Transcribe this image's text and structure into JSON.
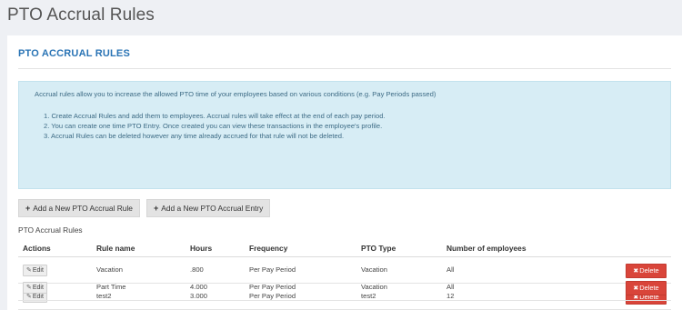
{
  "page": {
    "title": "PTO Accrual Rules"
  },
  "panel": {
    "heading": "PTO ACCRUAL RULES"
  },
  "info": {
    "intro": "Accrual rules allow you to increase the allowed PTO time of your employees based on various conditions (e.g. Pay Periods passed)",
    "items": [
      "1. Create Accrual Rules and add them to employees. Accrual rules will take effect at the end of each pay period.",
      "2. You can create one time PTO Entry. Once created you can view these transactions in the employee's profile.",
      "3. Accrual Rules can be deleted however any time already accrued for that rule will not be deleted."
    ]
  },
  "buttons": {
    "add_rule": "Add a New PTO Accrual Rule",
    "add_entry": "Add a New PTO Accrual Entry",
    "plus_icon": "+",
    "edit_label": "Edit",
    "edit_icon": "✎",
    "delete_label": "Delete",
    "delete_icon": "✖"
  },
  "table": {
    "label": "PTO Accrual Rules",
    "headers": [
      "Actions",
      "Rule name",
      "Hours",
      "Frequency",
      "PTO Type",
      "Number of employees"
    ],
    "rows": [
      {
        "rule_name": "Vacation",
        "hours": ".800",
        "frequency": "Per Pay Period",
        "pto_type": "Vacation",
        "employees": "All"
      },
      {
        "rule_name": "test2",
        "hours": "3.000",
        "frequency": "Per Pay Period",
        "pto_type": "test2",
        "employees": "12"
      },
      {
        "rule_name": "Part Time",
        "hours": "4.000",
        "frequency": "Per Pay Period",
        "pto_type": "Vacation",
        "employees": "All"
      }
    ]
  },
  "colors": {
    "heading_blue": "#2a74b5",
    "info_bg": "#d7edf5",
    "delete_red": "#d9453a"
  }
}
